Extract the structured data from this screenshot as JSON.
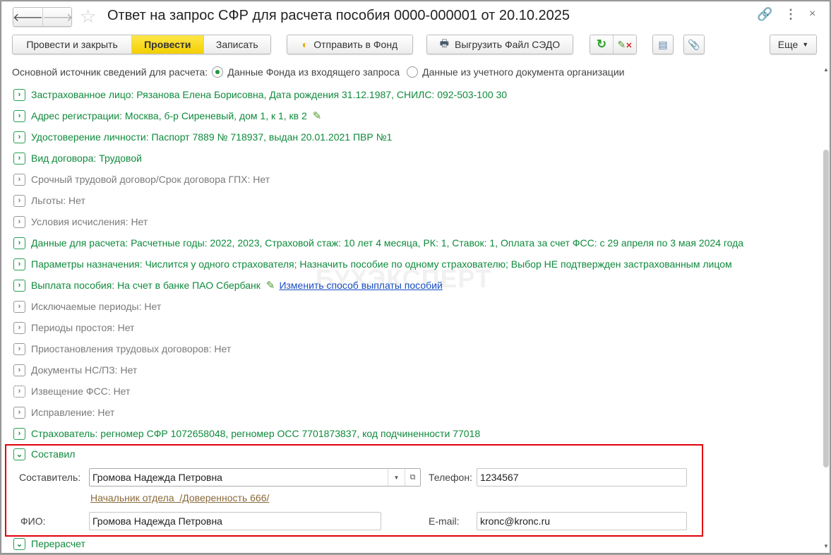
{
  "window": {
    "title": "Ответ на запрос СФР для расчета пособия 0000-000001 от 20.10.2025"
  },
  "toolbar": {
    "post_close": "Провести и закрыть",
    "post": "Провести",
    "save": "Записать",
    "send_fund": "Отправить в Фонд",
    "export_sedo": "Выгрузить Файл СЭДО",
    "more": "Еще"
  },
  "source": {
    "label": "Основной источник сведений для расчета:",
    "options": [
      {
        "label": "Данные Фонда из входящего запроса",
        "selected": true
      },
      {
        "label": "Данные из учетного документа организации",
        "selected": false
      }
    ]
  },
  "sections": [
    {
      "text": "Застрахованное лицо: Рязанова Елена Борисовна, Дата рождения 31.12.1987, СНИЛС: 092-503-100 30",
      "active": true
    },
    {
      "text": "Адрес регистрации: Москва, б-р Сиреневый, дом 1, к 1, кв 2",
      "active": true,
      "edit": true
    },
    {
      "text": "Удостоверение личности: Паспорт 7889 № 718937, выдан 20.01.2021 ПВР №1",
      "active": true
    },
    {
      "text": "Вид договора: Трудовой",
      "active": true
    },
    {
      "text": "Срочный трудовой договор/Срок договора ГПХ: Нет",
      "active": false
    },
    {
      "text": "Льготы: Нет",
      "active": false
    },
    {
      "text": "Условия исчисления: Нет",
      "active": false
    },
    {
      "text": "Данные для расчета: Расчетные годы: 2022, 2023, Страховой стаж: 10 лет 4 месяца, РК: 1, Ставок: 1, Оплата за счет ФСС: с 29 апреля по 3 мая 2024 года",
      "active": true
    },
    {
      "text": "Параметры назначения: Числится у одного страхователя; Назначить пособие по одному страхователю; Выбор НЕ подтвержден застрахованным лицом",
      "active": true
    },
    {
      "text": "Выплата пособия: На счет в банке ПАО Сбербанк",
      "active": true,
      "edit": true,
      "link": "Изменить способ выплаты пособий"
    },
    {
      "text": "Исключаемые периоды: Нет",
      "active": false
    },
    {
      "text": "Периоды простоя: Нет",
      "active": false
    },
    {
      "text": "Приостановления трудовых договоров: Нет",
      "active": false
    },
    {
      "text": "Документы НС/ПЗ: Нет",
      "active": false
    },
    {
      "text": "Извещение ФСС: Нет",
      "active": false
    },
    {
      "text": "Исправление: Нет",
      "active": false
    },
    {
      "text": "Страхователь: регномер СФР 1072658048, регномер ОСС 7701873837, код подчиненности 77018",
      "active": true
    }
  ],
  "composed": {
    "title": "Составил",
    "author_label": "Составитель:",
    "author": "Громова Надежда Петровна",
    "position_link": "Начальник отдела  /Доверенность 666/",
    "fio_label": "ФИО:",
    "fio": "Громова Надежда Петровна",
    "phone_label": "Телефон:",
    "phone": "1234567",
    "email_label": "E-mail:",
    "email": "kronc@kronc.ru"
  },
  "recalc": {
    "title": "Перерасчет"
  },
  "watermark": "БУХЭКСПЕРТ"
}
